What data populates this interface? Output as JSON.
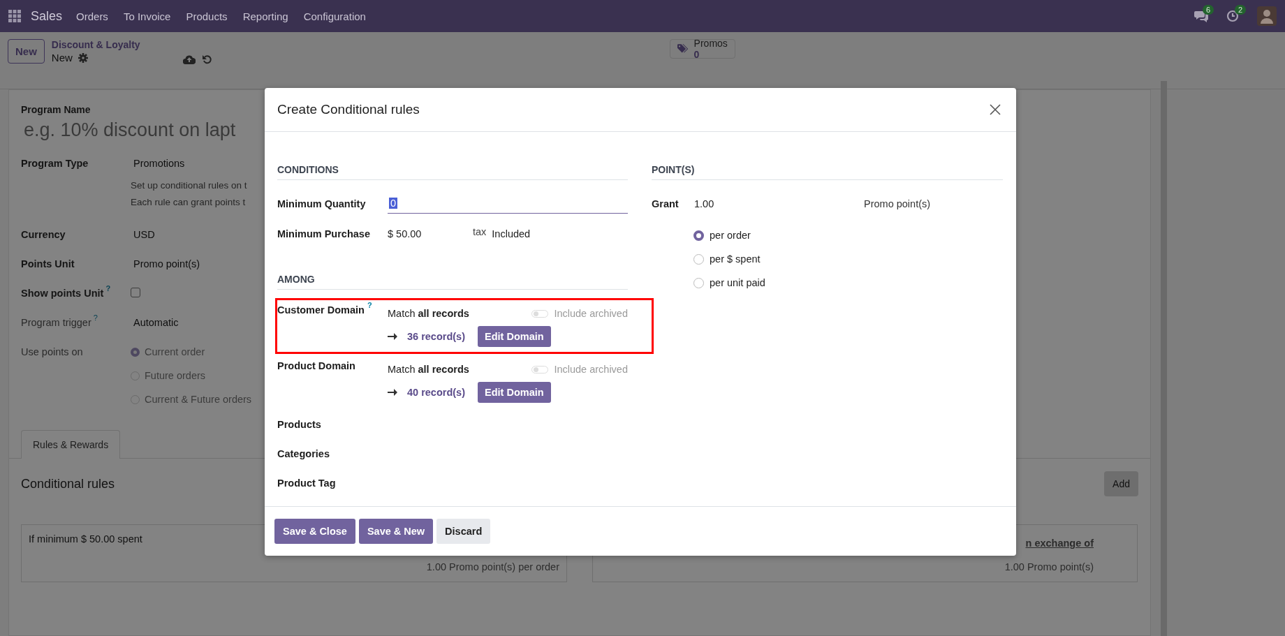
{
  "navbar": {
    "app": "Sales",
    "menu": [
      "Orders",
      "To Invoice",
      "Products",
      "Reporting",
      "Configuration"
    ],
    "messages_count": "6",
    "activities_count": "2"
  },
  "control_panel": {
    "new_button": "New",
    "breadcrumb": "Discount & Loyalty",
    "record": "New",
    "smart_button": {
      "label": "Promos",
      "value": "0"
    }
  },
  "form": {
    "program_name_label": "Program Name",
    "program_name_placeholder": "e.g. 10% discount on lapt",
    "fields": [
      {
        "kind": "text",
        "label": "Program Type",
        "value": "Promotions",
        "notes": [
          "Set up conditional rules on t",
          "Each rule can grant points t"
        ],
        "muted": false
      },
      {
        "kind": "text",
        "label": "Currency",
        "value": "USD",
        "muted": false
      },
      {
        "kind": "text",
        "label": "Points Unit",
        "value": "Promo point(s)",
        "muted": false
      },
      {
        "kind": "checkbox",
        "label": "Show points Unit",
        "help": "?",
        "checked": false,
        "muted": false
      },
      {
        "kind": "text",
        "label": "Program trigger",
        "help": "?",
        "value": "Automatic",
        "muted": true
      },
      {
        "kind": "radio",
        "label": "Use points on",
        "muted": true,
        "options": [
          {
            "label": "Current order",
            "selected": true
          },
          {
            "label": "Future orders",
            "selected": false
          },
          {
            "label": "Current & Future orders",
            "selected": false
          }
        ]
      }
    ],
    "tabs": [
      {
        "label": "Rules & Rewards",
        "selected": true
      }
    ],
    "rules": {
      "title": "Conditional rules",
      "add_button": "Add",
      "rule_card": {
        "condition": "If minimum $ 50.00 spent",
        "grant": "1.00 Promo point(s) per order"
      },
      "reward_card": {
        "link": "n exchange of",
        "cost": "1.00 Promo point(s)"
      }
    }
  },
  "dialog": {
    "title": "Create Conditional rules",
    "conditions": {
      "heading": "CONDITIONS",
      "min_qty": {
        "label": "Minimum Quantity",
        "value": "0",
        "text_selected": true
      },
      "min_purchase": {
        "label": "Minimum Purchase",
        "value": "$ 50.00",
        "tax_label": "tax",
        "tax_value": "Included"
      }
    },
    "among": {
      "heading": "AMONG",
      "domains": [
        {
          "label": "Customer Domain",
          "help": "?",
          "match": "Match **all records**",
          "include_archived": {
            "label": "Include archived",
            "on": false
          },
          "records": "36 record(s)",
          "button": "Edit Domain",
          "highlighted": true
        },
        {
          "label": "Product Domain",
          "match": "Match **all records**",
          "include_archived": {
            "label": "Include archived",
            "on": false
          },
          "records": "40 record(s)",
          "button": "Edit Domain",
          "highlighted": false
        }
      ],
      "fields": [
        "Products",
        "Categories",
        "Product Tag"
      ]
    },
    "points": {
      "heading": "POINT(S)",
      "grant_label": "Grant",
      "grant_value": "1.00",
      "unit": "Promo point(s)",
      "modes": [
        {
          "label": "per order",
          "selected": true
        },
        {
          "label": "per $ spent",
          "selected": false
        },
        {
          "label": "per unit paid",
          "selected": false
        }
      ]
    },
    "buttons": [
      {
        "label": "Save & Close",
        "kind": "primary"
      },
      {
        "label": "Save & New",
        "kind": "primary"
      },
      {
        "label": "Discard",
        "kind": "secondary"
      }
    ]
  }
}
